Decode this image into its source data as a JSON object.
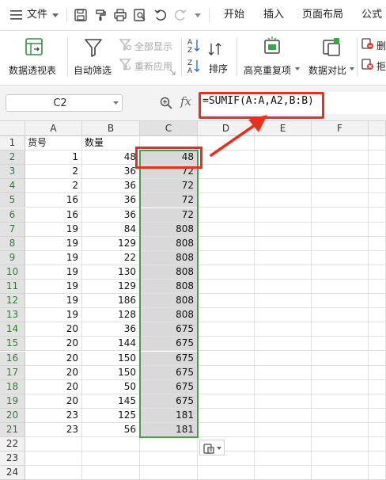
{
  "menu": {
    "file_label": "文件",
    "tabs": [
      "开始",
      "插入",
      "页面布局",
      "公式"
    ]
  },
  "ribbon": {
    "pivot_label": "数据透视表",
    "autofilter_label": "自动筛选",
    "show_all_label": "全部显示",
    "reapply_label": "重新应用",
    "sort_label": "排序",
    "highlight_dup_label": "高亮重复项",
    "compare_label": "数据对比",
    "delete_dup_label": "删",
    "reject_dup_label": "拒"
  },
  "formula_bar": {
    "name_box": "C2",
    "fx_symbol": "fx",
    "formula": "=SUMIF(A:A,A2,B:B)"
  },
  "sheet": {
    "columns": [
      "A",
      "B",
      "C",
      "D",
      "E",
      "F"
    ],
    "rows": [
      {
        "n": "1",
        "a": "货号",
        "b": "数量",
        "c": ""
      },
      {
        "n": "2",
        "a": "1",
        "b": "48",
        "c": "48"
      },
      {
        "n": "3",
        "a": "2",
        "b": "36",
        "c": "72"
      },
      {
        "n": "4",
        "a": "2",
        "b": "36",
        "c": "72"
      },
      {
        "n": "5",
        "a": "16",
        "b": "36",
        "c": "72"
      },
      {
        "n": "6",
        "a": "16",
        "b": "36",
        "c": "72"
      },
      {
        "n": "7",
        "a": "19",
        "b": "84",
        "c": "808"
      },
      {
        "n": "8",
        "a": "19",
        "b": "129",
        "c": "808"
      },
      {
        "n": "9",
        "a": "19",
        "b": "22",
        "c": "808"
      },
      {
        "n": "10",
        "a": "19",
        "b": "130",
        "c": "808"
      },
      {
        "n": "11",
        "a": "19",
        "b": "129",
        "c": "808"
      },
      {
        "n": "12",
        "a": "19",
        "b": "186",
        "c": "808"
      },
      {
        "n": "13",
        "a": "19",
        "b": "128",
        "c": "808"
      },
      {
        "n": "14",
        "a": "20",
        "b": "36",
        "c": "675"
      },
      {
        "n": "15",
        "a": "20",
        "b": "144",
        "c": "675"
      },
      {
        "n": "16",
        "a": "20",
        "b": "150",
        "c": "675"
      },
      {
        "n": "17",
        "a": "20",
        "b": "150",
        "c": "675"
      },
      {
        "n": "18",
        "a": "20",
        "b": "50",
        "c": "675"
      },
      {
        "n": "19",
        "a": "20",
        "b": "145",
        "c": "675"
      },
      {
        "n": "20",
        "a": "23",
        "b": "125",
        "c": "181"
      },
      {
        "n": "21",
        "a": "23",
        "b": "56",
        "c": "181"
      },
      {
        "n": "22",
        "a": "",
        "b": "",
        "c": ""
      },
      {
        "n": "23",
        "a": "",
        "b": "",
        "c": ""
      },
      {
        "n": "24",
        "a": "",
        "b": "",
        "c": ""
      }
    ]
  },
  "colors": {
    "accent_red": "#e8301c",
    "selection_green": "#4a9d4a",
    "header_gray": "#f2f2f2"
  }
}
